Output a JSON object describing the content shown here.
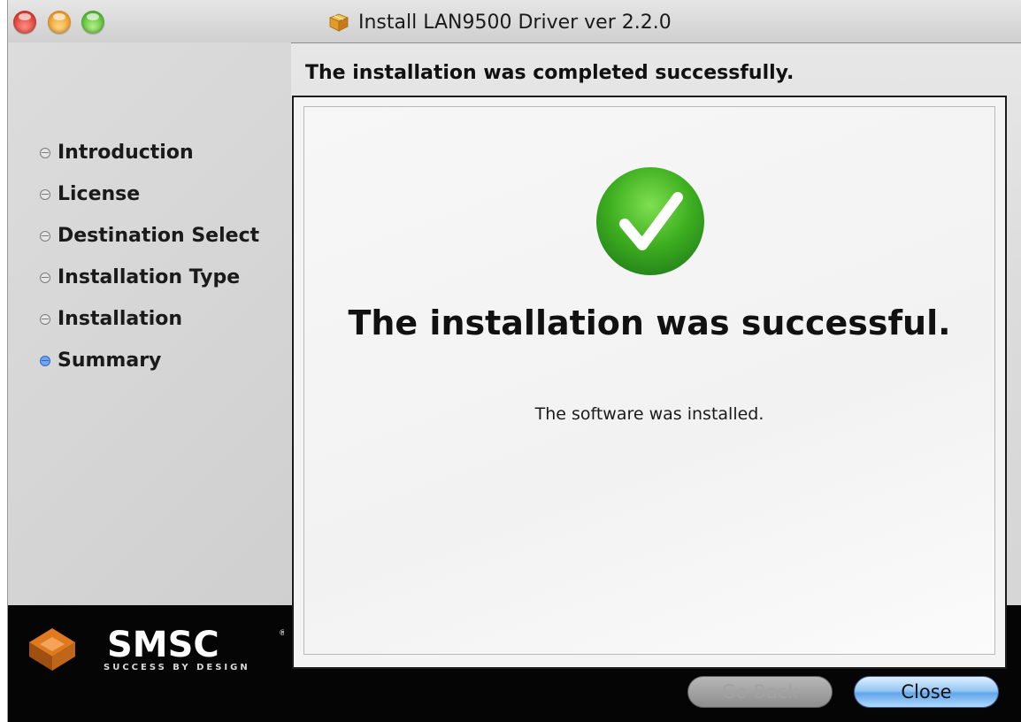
{
  "window": {
    "title": "Install LAN9500 Driver ver 2.2.0"
  },
  "header": {
    "status": "The installation was completed successfully."
  },
  "sidebar": {
    "steps": [
      {
        "label": "Introduction",
        "active": false
      },
      {
        "label": "License",
        "active": false
      },
      {
        "label": "Destination Select",
        "active": false
      },
      {
        "label": "Installation Type",
        "active": false
      },
      {
        "label": "Installation",
        "active": false
      },
      {
        "label": "Summary",
        "active": true
      }
    ]
  },
  "content": {
    "title": "The installation was successful.",
    "message": "The software was installed."
  },
  "logo": {
    "brand": "SMSC",
    "tagline": "SUCCESS BY DESIGN"
  },
  "buttons": {
    "back_label": "Go Back",
    "close_label": "Close"
  },
  "colors": {
    "success_green": "#3dae1f",
    "accent_blue": "#62a6ea",
    "logo_orange": "#e07a1f"
  }
}
